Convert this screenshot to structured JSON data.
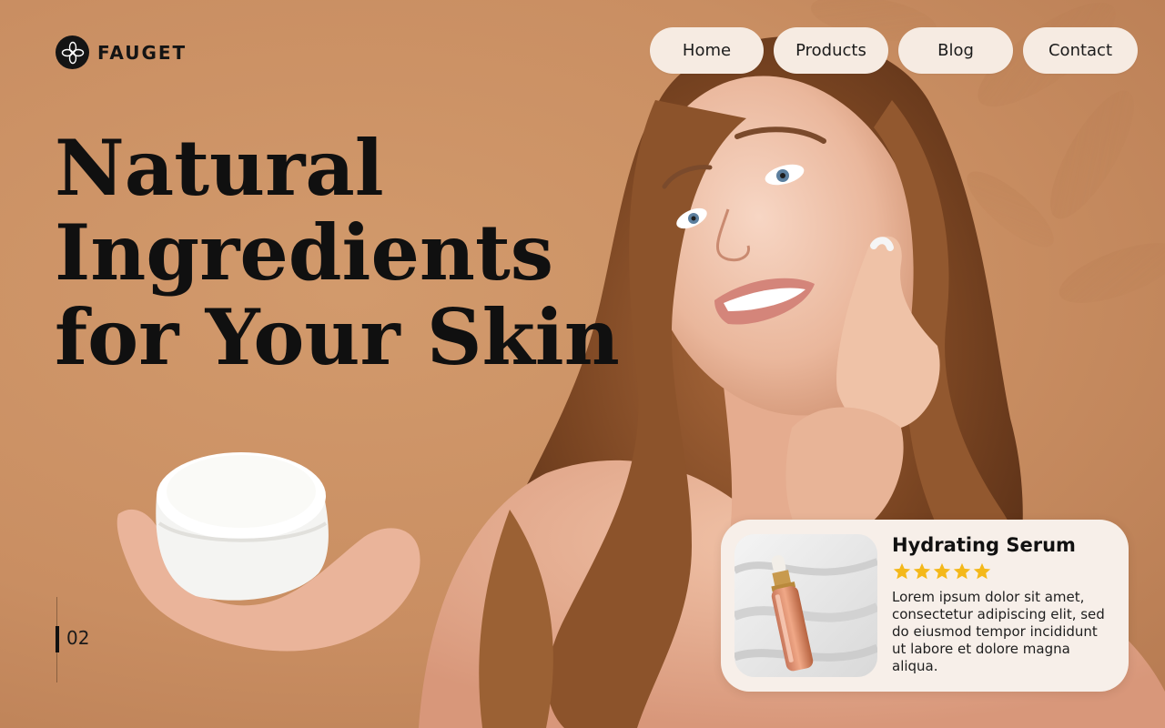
{
  "brand": {
    "name": "FAUGET",
    "logo_icon": "flower-logo-icon"
  },
  "nav": {
    "items": [
      {
        "label": "Home"
      },
      {
        "label": "Products"
      },
      {
        "label": "Blog"
      },
      {
        "label": "Contact"
      }
    ]
  },
  "hero": {
    "headline_lines": [
      "Natural",
      "Ingredients",
      "for Your Skin"
    ],
    "image_subject": "woman-holding-cream-jar-photo",
    "background_color": "#c98e62"
  },
  "slider": {
    "current_slide": "02"
  },
  "product_card": {
    "title": "Hydrating Serum",
    "rating": 5,
    "rating_max": 5,
    "star_color": "#f4b81a",
    "image_subject": "serum-dropper-bottle-photo",
    "description": "Lorem ipsum dolor sit amet, consectetur adipiscing elit, sed do eiusmod tempor incididunt ut labore et dolore magna aliqua."
  }
}
